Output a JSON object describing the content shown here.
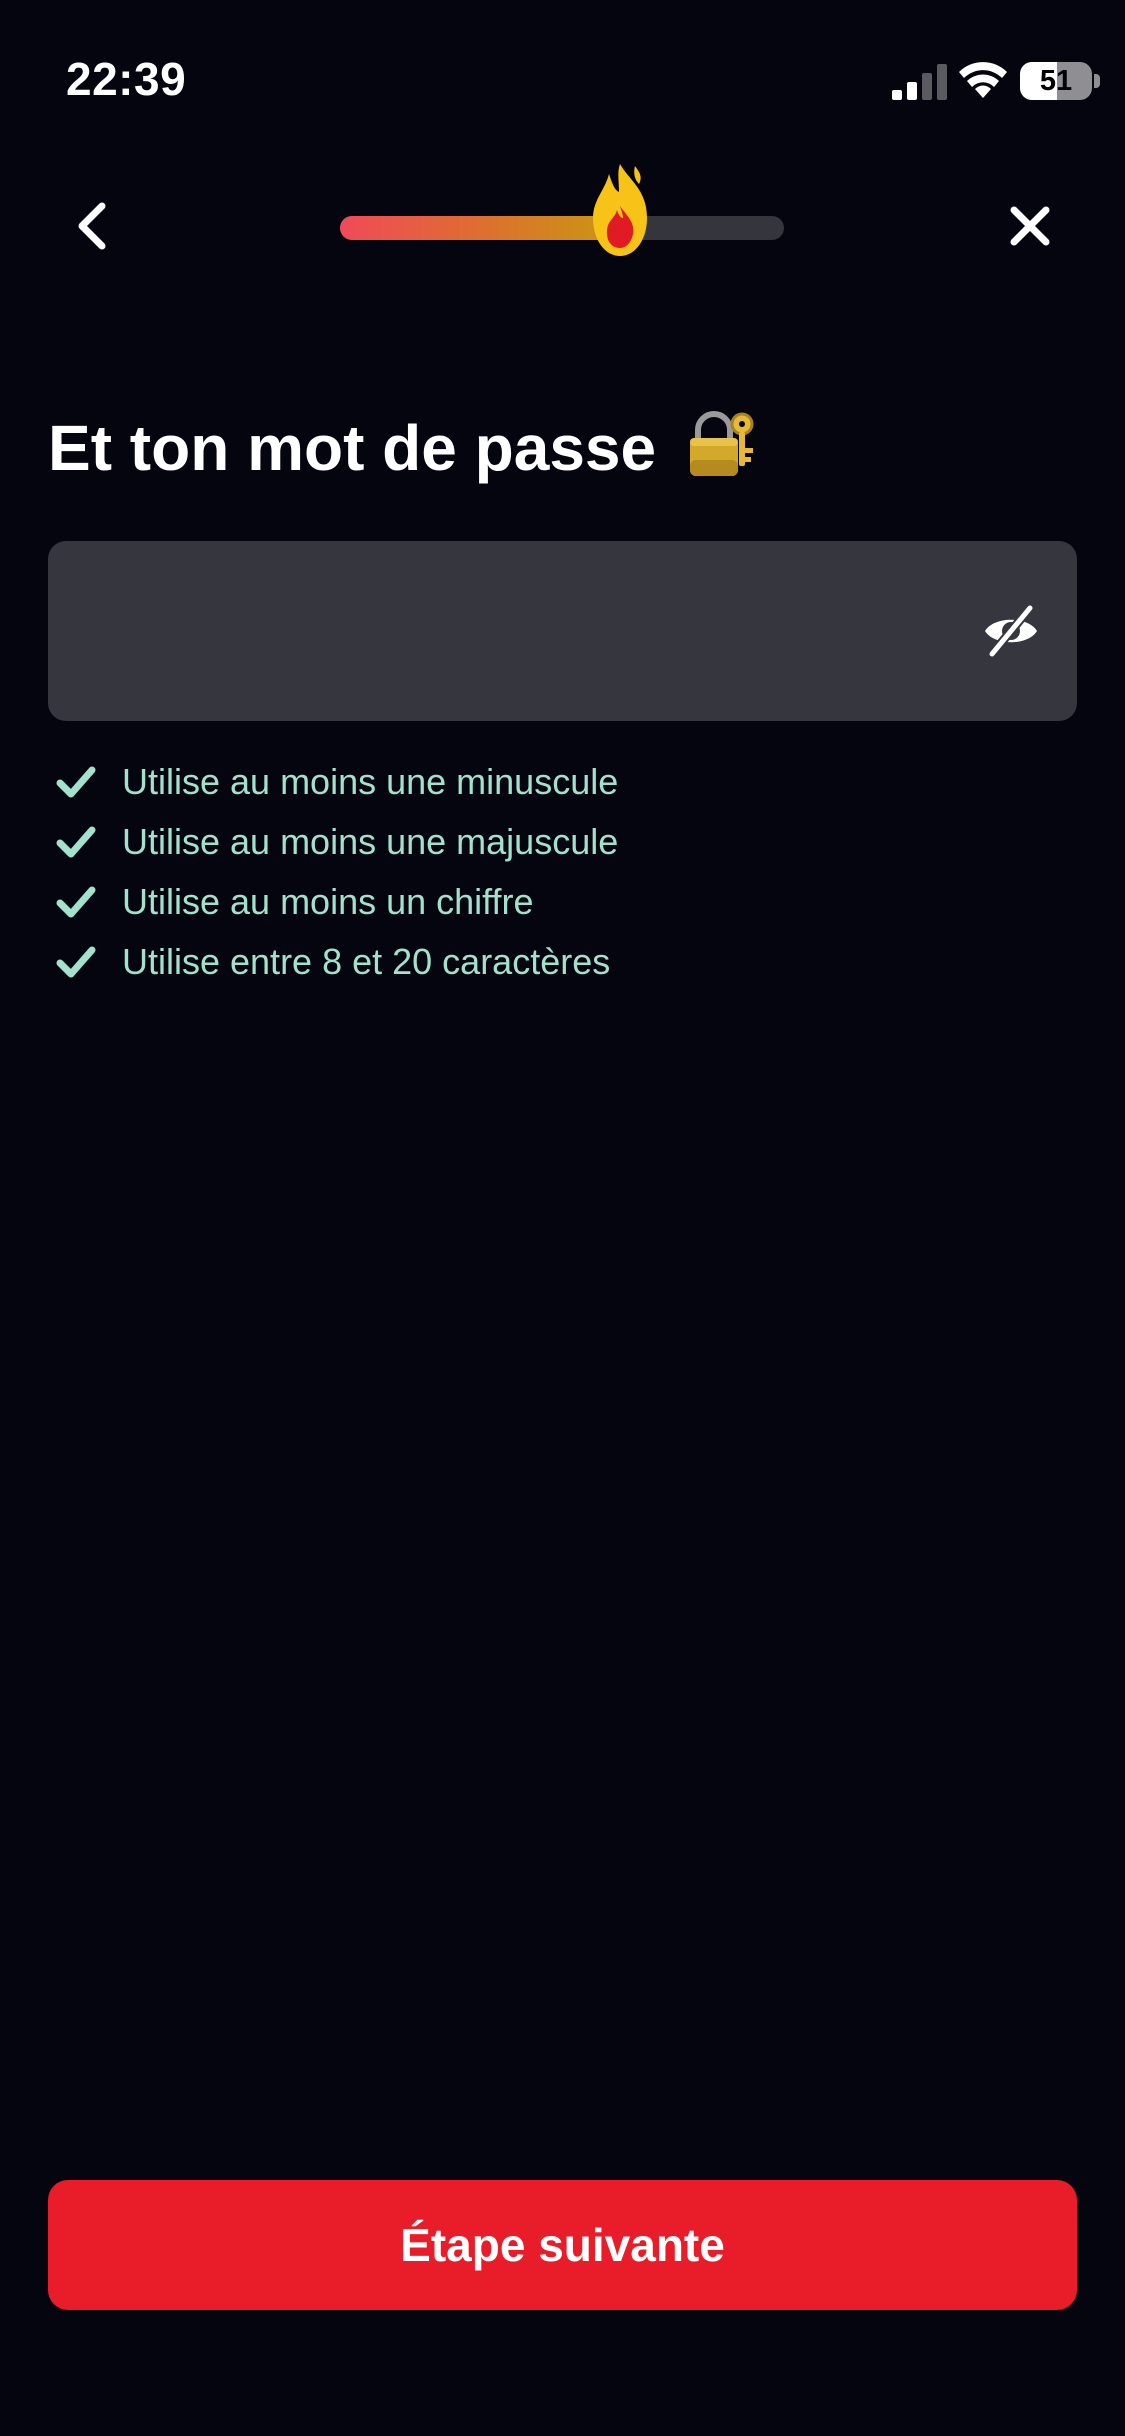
{
  "status_bar": {
    "time": "22:39",
    "battery_level": "51",
    "battery_fraction": 0.51,
    "signal_bars_active": 2,
    "signal_bars_total": 4
  },
  "progress": {
    "fraction": 0.63
  },
  "screen": {
    "title": "Et ton mot de passe",
    "title_icon": "locked-with-key-icon"
  },
  "password_field": {
    "value": "",
    "placeholder": "",
    "visibility_icon": "eye-off-icon"
  },
  "requirements": [
    {
      "label": "Utilise au moins une minuscule",
      "met": true
    },
    {
      "label": "Utilise au moins une majuscule",
      "met": true
    },
    {
      "label": "Utilise au moins un chiffre",
      "met": true
    },
    {
      "label": "Utilise entre 8 et 20 caractères",
      "met": true
    }
  ],
  "actions": {
    "next_label": "Étape suivante"
  },
  "colors": {
    "background": "#050510",
    "field": "#36363f",
    "check": "#a2e2cd",
    "button": "#e91c2a",
    "progress_track": "#35353e",
    "progress_start": "#f04a5a",
    "progress_end": "#c99810"
  }
}
